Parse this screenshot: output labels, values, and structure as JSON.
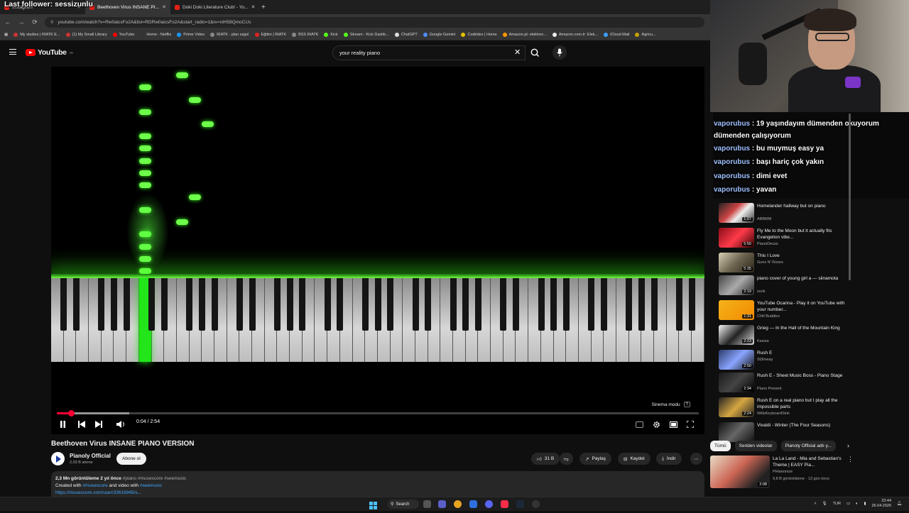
{
  "overlay": {
    "last_follower": "Last follower: sessizunlu"
  },
  "tabs": [
    {
      "label": "Instagram",
      "active": false
    },
    {
      "label": "Beethoven Virus INSANE PI...",
      "active": true
    },
    {
      "label": "Doki Doki Literature Club! - Yo...",
      "active": false
    }
  ],
  "url": "youtube.com/watch?v=Rw0aicsFo2A&list=RDRw0aicsFo2A&start_radio=1&rv=niH58QmoCUs",
  "bookmarks": [
    "My studies | RIATK E...",
    "(1) My Small Library",
    "YouTube",
    "Home - Netflix",
    "Prime Video",
    "RIATK - plan zajęć",
    "Eğitim | RIATK",
    "BSS RIATK",
    "Kick",
    "Stream - Kick Dashb...",
    "ChatGPT",
    "Google Gemini",
    "Codédex | Home",
    "Amazon.pl: elektron...",
    "Amazon.com.tr: Elek...",
    "iCloud Mail",
    "Agricu..."
  ],
  "header": {
    "logo_text": "YouTube",
    "logo_region": "TR",
    "search_value": "your reality piano"
  },
  "player": {
    "current_time": "0:04",
    "duration": "2:54",
    "time_display": "0:04 / 2:54",
    "progress_fraction": 0.023,
    "cinema_mode_label": "Sinema modu",
    "cinema_mode_key": "T"
  },
  "video": {
    "title": "Beethoven Virus INSANE PIANO VERSION",
    "channel": "Pianoly Official",
    "subscribers": "2,03 B abone",
    "subscribe_label": "Abone ol",
    "likes": "31 B",
    "share_label": "Paylaş",
    "save_label": "Kaydet",
    "download_label": "İndir",
    "description": {
      "stats": "2,3 Mn görüntüleme  2 yıl önce",
      "tags": "#piano #musescore #seemusic",
      "line2_prefix": "Created with",
      "line2_link1": "#musescore",
      "line2_mid": "and video with",
      "line2_link2": "#seemusic",
      "line3": "https://musescore.com/user/33616945/s..."
    }
  },
  "chat": [
    {
      "user": "vaporubus",
      "text": "19 yaşındayım dümenden okuyorum dümenden çalışıyorum"
    },
    {
      "user": "vaporubus",
      "text": "bu muymuş easy ya"
    },
    {
      "user": "vaporubus",
      "text": "başı hariç çok yakın"
    },
    {
      "user": "vaporubus",
      "text": "dimi evet"
    },
    {
      "user": "vaporubus",
      "text": "yavan"
    }
  ],
  "recommendations": [
    {
      "title": "Homelander hallway but on piano",
      "channel": "ABBMM",
      "duration": "1:07"
    },
    {
      "title": "Fly Me to the Moon but it actually fits Evangelion vibe...",
      "channel": "PianoDeuss",
      "duration": "5:50"
    },
    {
      "title": "This I Love",
      "channel": "Guns N' Roses",
      "duration": "5:35"
    },
    {
      "title": "piano cover of young girl a — siinamota",
      "channel": "sook",
      "duration": "2:19"
    },
    {
      "title": "YouTube Ocarina - Play it on YouTube with your number...",
      "channel": "Chill Buddies",
      "duration": "1:31"
    },
    {
      "title": "Grieg — In the Hall of the Mountain King",
      "channel": "Kassia",
      "duration": "2:23"
    },
    {
      "title": "Rush E",
      "channel": "St3inway",
      "duration": "2:50"
    },
    {
      "title": "Rush E - Sheet Music Boss - Piano Stage",
      "channel": "Piano Present",
      "duration": "2:34"
    },
    {
      "title": "Rush E on a real piano but I play all the impossible parts",
      "channel": "WillsKeyboardSink",
      "duration": "2:24"
    },
    {
      "title": "Vivaldi - Winter (The Four Seasons)",
      "channel": "",
      "duration": ""
    }
  ],
  "chips": [
    "Tümü",
    "Seriden videolar",
    "Pianoly Official adlı y..."
  ],
  "bottom_rec": {
    "title": "La La Land - Mia and Sebastian's Theme | EASY Pia...",
    "channel": "PHianonize",
    "meta": "9,8 B görüntüleme · 13 gün önce",
    "duration": "2:08"
  },
  "taskbar": {
    "search_label": "Search",
    "lang": "TUR",
    "time": "23:44",
    "date": "26.04.2026"
  },
  "colors": {
    "accent": "#ff0033",
    "note_green": "#6dff4a",
    "link": "#3ea6ff"
  }
}
